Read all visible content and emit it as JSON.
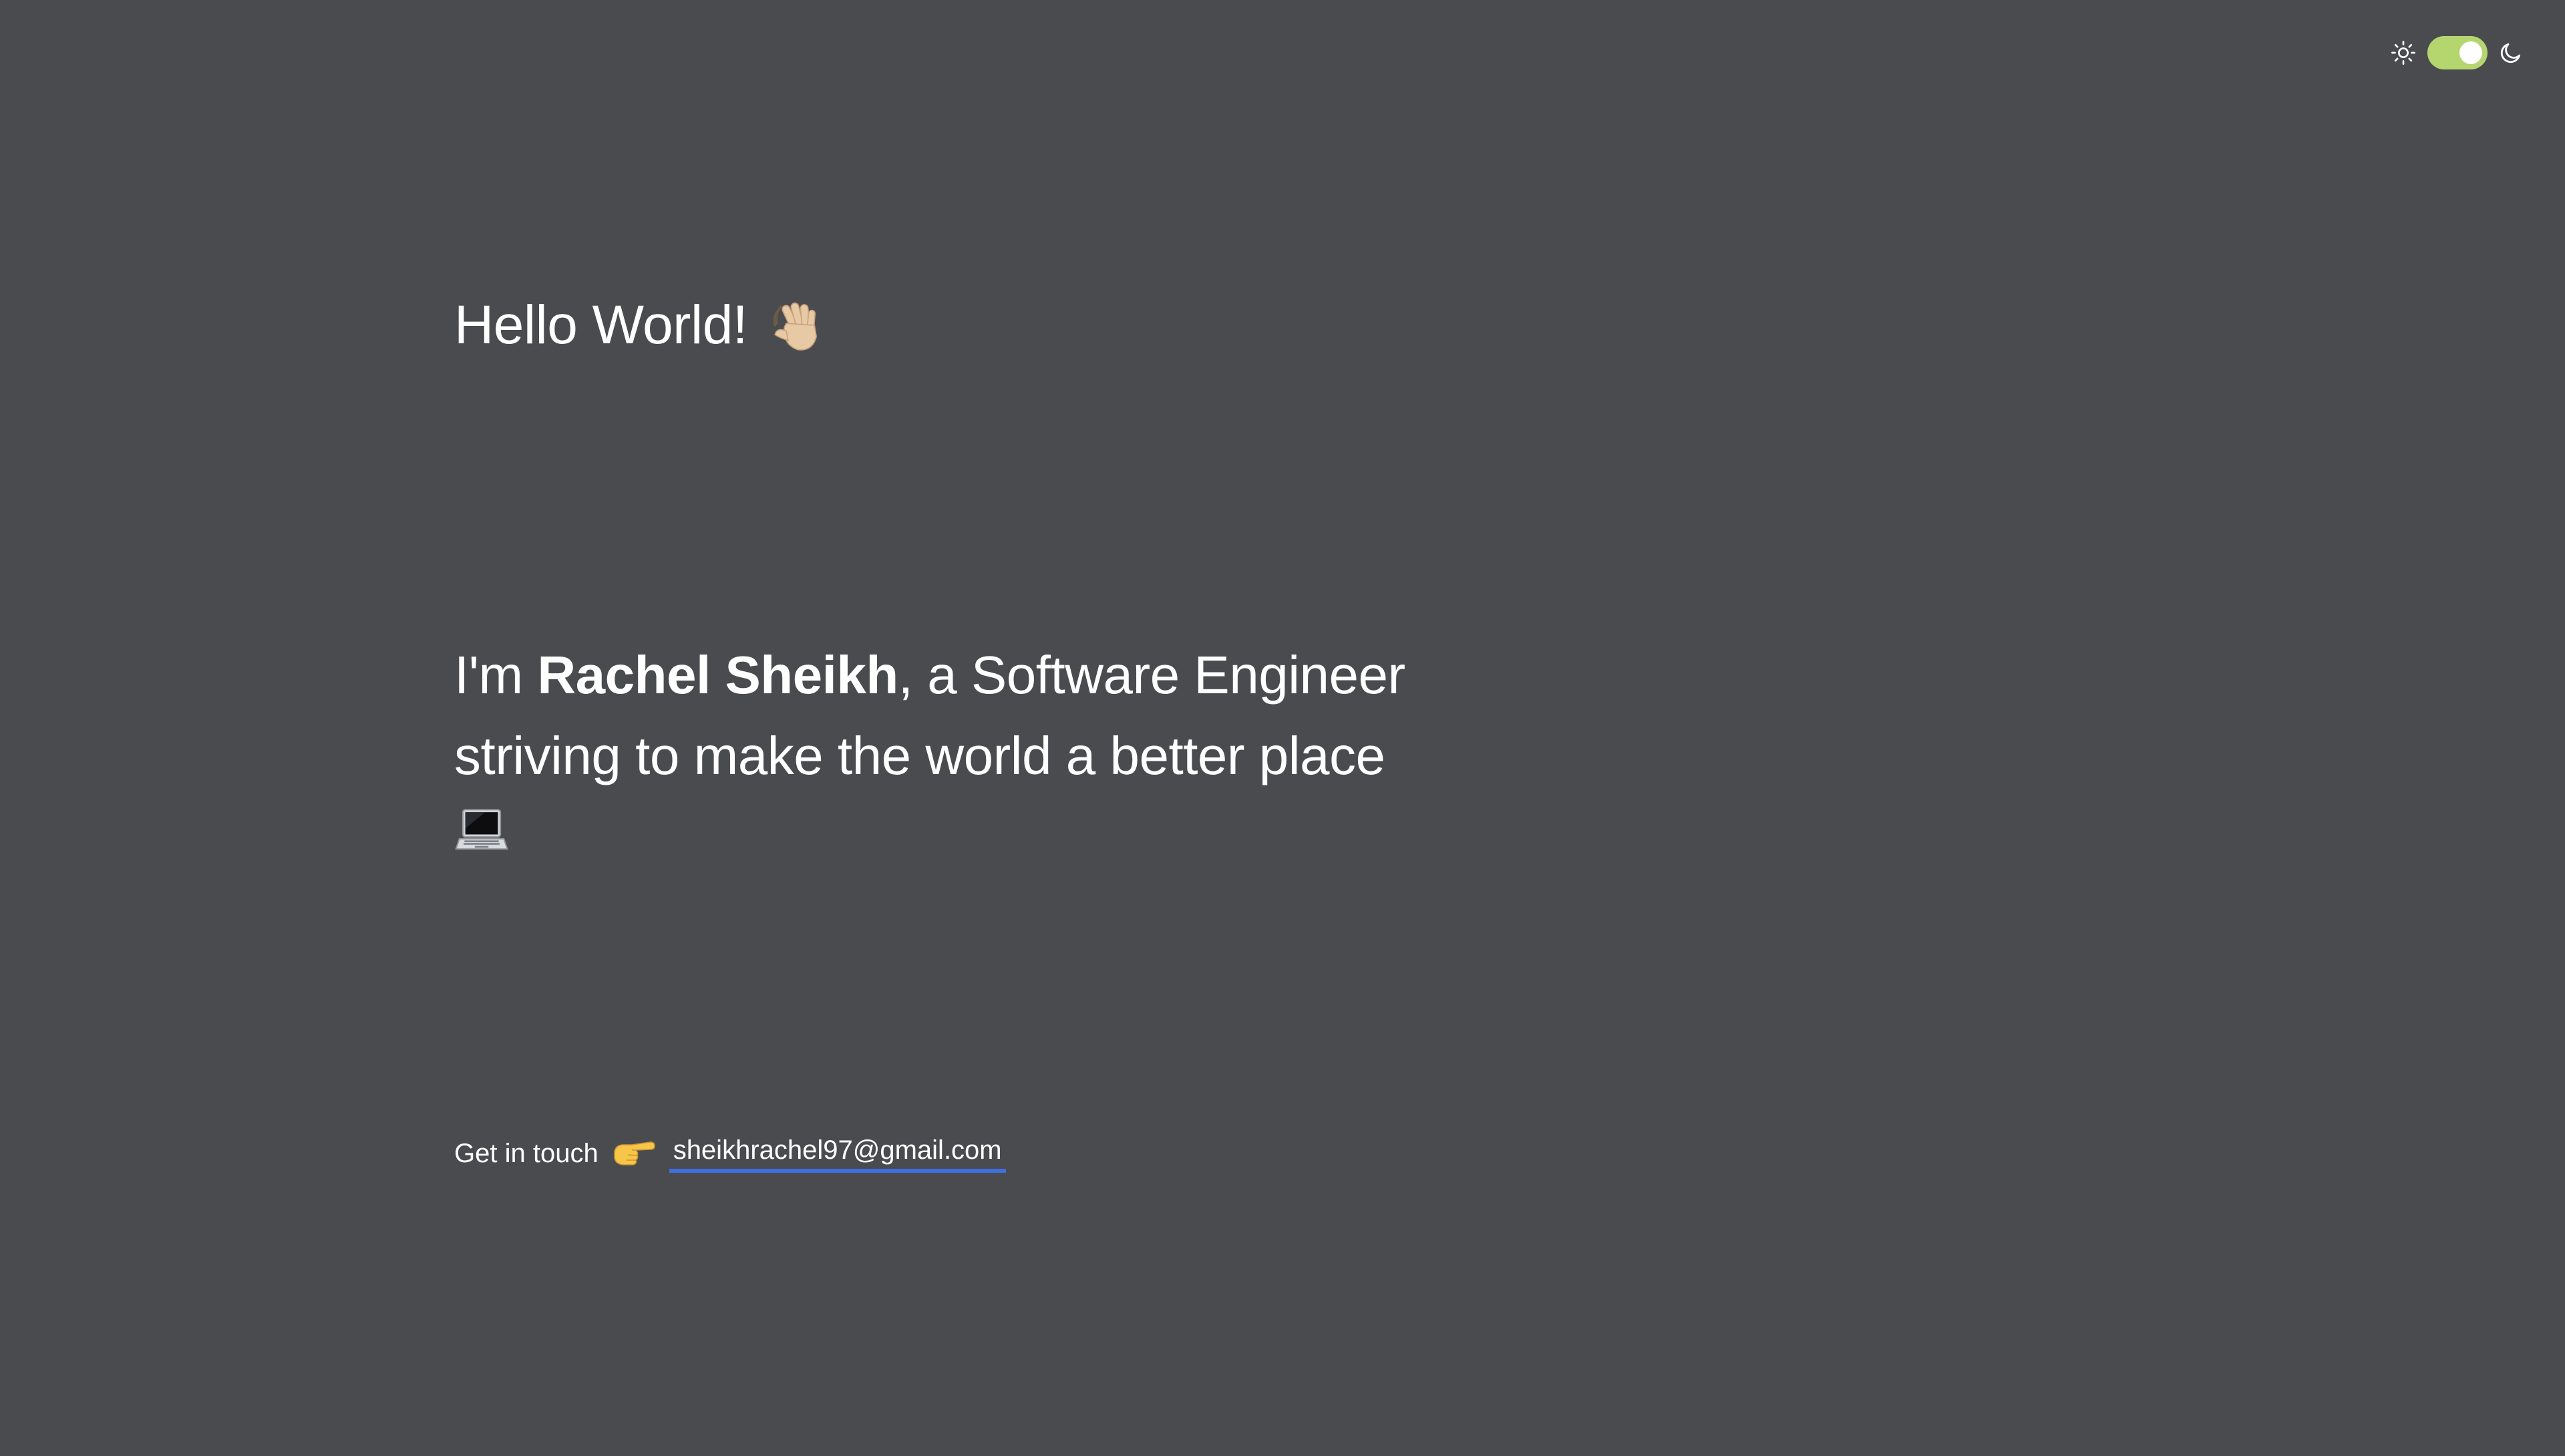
{
  "theme_toggle": {
    "light_icon": "sun-icon",
    "dark_icon": "moon-icon",
    "state": "on",
    "track_color": "#b5d66f",
    "knob_color": "#ffffff"
  },
  "greeting": {
    "text": "Hello World!",
    "icon": "waving-hand-icon"
  },
  "intro": {
    "prefix": "I'm ",
    "name": "Rachel Sheikh",
    "suffix": ", a Software Engineer striving to make the world a better place",
    "icon": "laptop-icon"
  },
  "contact": {
    "label": "Get in touch",
    "icon": "pointing-hand-icon",
    "email": "sheikhrachel97@gmail.com",
    "link_underline_color": "#3d6fe0"
  },
  "colors": {
    "background": "#4a4b4e",
    "text": "#ffffff"
  }
}
